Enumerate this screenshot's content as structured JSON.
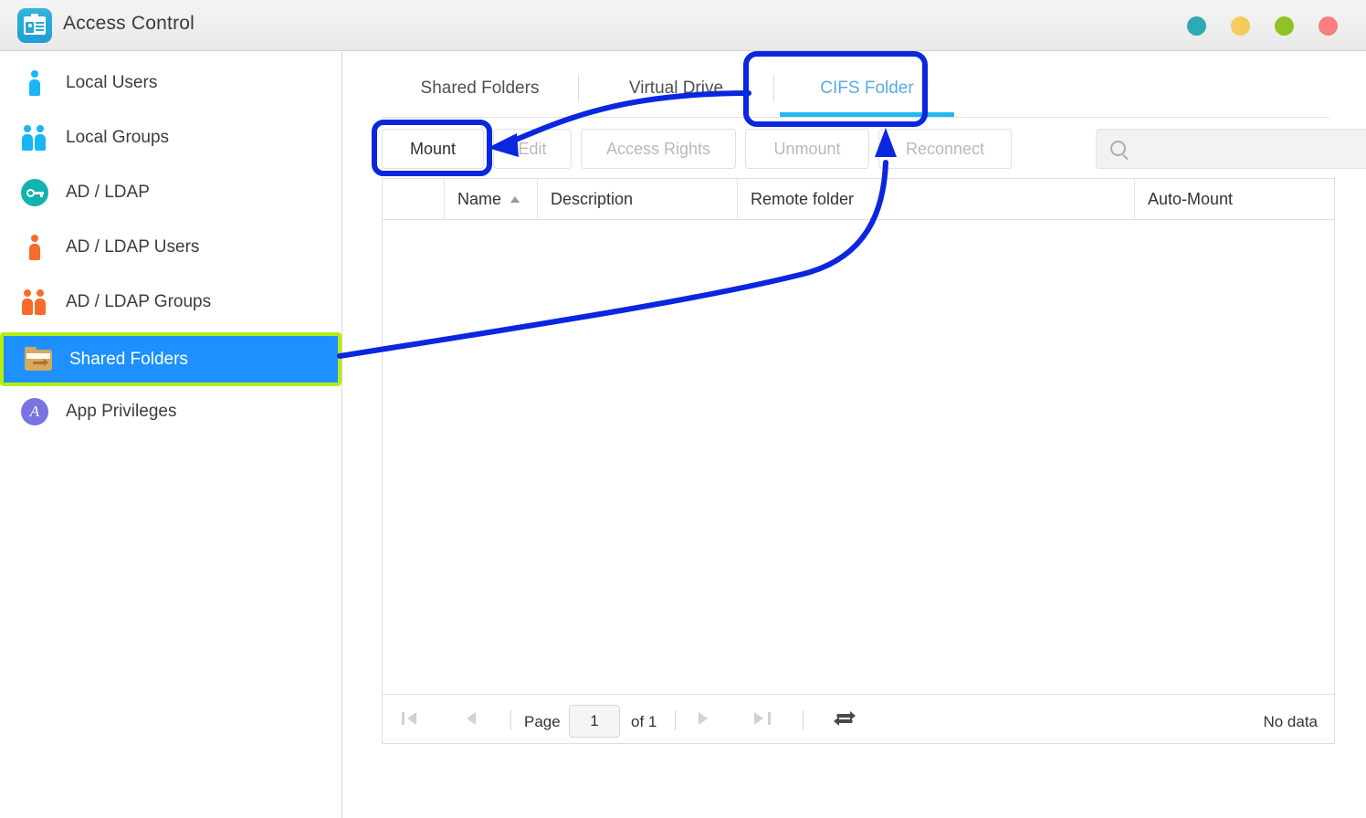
{
  "window": {
    "title": "Access Control",
    "app_icon": "id-card-icon",
    "controls": [
      {
        "name": "teal-dot",
        "color": "#2eaab4"
      },
      {
        "name": "yellow-dot",
        "color": "#f5cc5b"
      },
      {
        "name": "green-dot",
        "color": "#8ec225"
      },
      {
        "name": "red-dot",
        "color": "#fa7e7e"
      }
    ]
  },
  "sidebar": {
    "items": [
      {
        "label": "Local Users",
        "icon": "person-icon",
        "selected": false
      },
      {
        "label": "Local Groups",
        "icon": "group-icon",
        "selected": false
      },
      {
        "label": "AD / LDAP",
        "icon": "key-icon",
        "selected": false
      },
      {
        "label": "AD / LDAP Users",
        "icon": "person-icon",
        "selected": false
      },
      {
        "label": "AD / LDAP Groups",
        "icon": "group-icon",
        "selected": false
      },
      {
        "label": "Shared Folders",
        "icon": "folder-icon",
        "selected": true
      },
      {
        "label": "App Privileges",
        "icon": "app-privileges-icon",
        "selected": false
      }
    ]
  },
  "main": {
    "tabs": [
      {
        "label": "Shared Folders",
        "active": false
      },
      {
        "label": "Virtual Drive",
        "active": false
      },
      {
        "label": "CIFS Folder",
        "active": true
      }
    ],
    "toolbar": {
      "buttons": [
        {
          "label": "Mount",
          "enabled": true
        },
        {
          "label": "Edit",
          "enabled": false
        },
        {
          "label": "Access Rights",
          "enabled": false
        },
        {
          "label": "Unmount",
          "enabled": false
        },
        {
          "label": "Reconnect",
          "enabled": false
        }
      ],
      "search": {
        "value": "",
        "placeholder": "",
        "icon": "search-icon"
      }
    },
    "table": {
      "columns": [
        "",
        "Name",
        "Description",
        "Remote folder",
        "",
        "Auto-Mount"
      ],
      "sort_column": "Name",
      "sort_direction": "ascending",
      "rows": [],
      "footer": {
        "page_label": "Page",
        "page_value": "1",
        "of_label": "of 1",
        "status": "No data",
        "first_icon": "first-page-icon",
        "prev_icon": "previous-page-icon",
        "next_icon": "next-page-icon",
        "last_icon": "last-page-icon",
        "refresh_icon": "refresh-icon"
      }
    }
  },
  "annotations": {
    "highlight_color": "#b2ee12",
    "arrow_color": "#0a26e0",
    "boxes": [
      {
        "target": "sidebar-item-shared-folders",
        "style": "green-outline"
      },
      {
        "target": "tab-cifs-folder",
        "style": "blue-outline"
      },
      {
        "target": "mount-button",
        "style": "blue-outline"
      }
    ],
    "arrows": [
      {
        "from": "sidebar-item-shared-folders",
        "to": "tab-cifs-folder"
      },
      {
        "from": "tab-cifs-folder",
        "to": "mount-button"
      }
    ]
  }
}
